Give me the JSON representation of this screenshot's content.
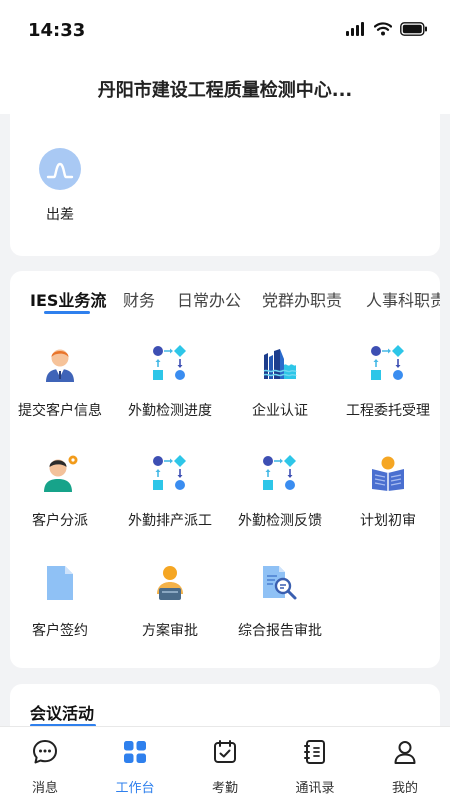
{
  "status_bar": {
    "time": "14:33"
  },
  "header": {
    "title": "丹阳市建设工程质量检测中心..."
  },
  "top_card": {
    "item_label": "出差"
  },
  "tabs": [
    {
      "label": "IES业务流",
      "active": true
    },
    {
      "label": "财务",
      "active": false
    },
    {
      "label": "日常办公",
      "active": false
    },
    {
      "label": "党群办职责",
      "active": false
    },
    {
      "label": "人事科职责",
      "active": false
    }
  ],
  "grid": [
    {
      "label": "提交客户信息",
      "icon": "person-icon"
    },
    {
      "label": "外勤检测进度",
      "icon": "flow-icon"
    },
    {
      "label": "企业认证",
      "icon": "factory-icon"
    },
    {
      "label": "工程委托受理",
      "icon": "flow-icon"
    },
    {
      "label": "客户分派",
      "icon": "person-gear-icon"
    },
    {
      "label": "外勤排产派工",
      "icon": "flow-icon"
    },
    {
      "label": "外勤检测反馈",
      "icon": "flow-icon"
    },
    {
      "label": "计划初审",
      "icon": "reader-icon"
    },
    {
      "label": "客户签约",
      "icon": "document-icon"
    },
    {
      "label": "方案审批",
      "icon": "worker-icon"
    },
    {
      "label": "综合报告审批",
      "icon": "report-search-icon"
    }
  ],
  "meeting": {
    "title": "会议活动"
  },
  "tabbar": [
    {
      "label": "消息",
      "icon": "chat-icon",
      "active": false
    },
    {
      "label": "工作台",
      "icon": "grid-icon",
      "active": true
    },
    {
      "label": "考勤",
      "icon": "calendar-check-icon",
      "active": false
    },
    {
      "label": "通讯录",
      "icon": "contacts-icon",
      "active": false
    },
    {
      "label": "我的",
      "icon": "user-icon",
      "active": false
    }
  ],
  "colors": {
    "accent": "#2f80ed",
    "background": "#f2f3f5"
  }
}
